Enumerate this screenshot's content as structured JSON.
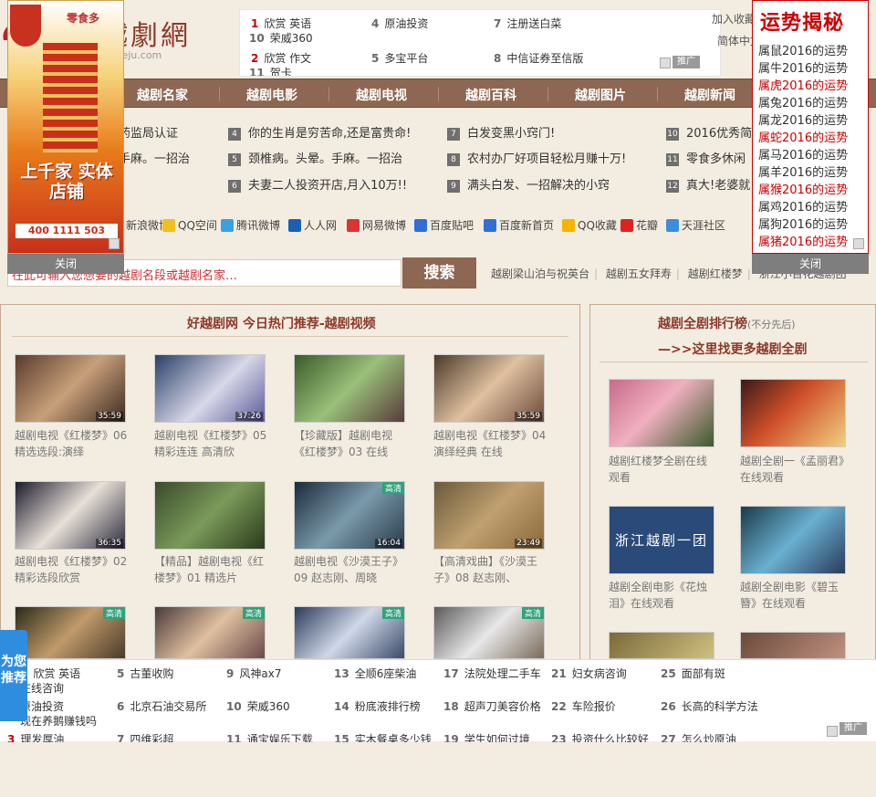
{
  "logo": {
    "text": "越劇網",
    "url": "yueju.com"
  },
  "top_ad": {
    "items": [
      {
        "n": "1",
        "label": "欣赏 英语"
      },
      {
        "n": "4",
        "label": "原油投资"
      },
      {
        "n": "7",
        "label": "注册送白菜"
      },
      {
        "n": "10",
        "label": "荣威360"
      },
      {
        "n": "2",
        "label": "欣赏 作文"
      },
      {
        "n": "5",
        "label": "多宝平台"
      },
      {
        "n": "8",
        "label": "中信证券至信版"
      },
      {
        "n": "11",
        "label": "贺卡"
      }
    ],
    "ad_tag": "推广"
  },
  "top_links": {
    "favorite": "加入收藏",
    "simplified": "简体中文"
  },
  "nav": [
    "越剧名家",
    "越剧电影",
    "越剧电视",
    "越剧百科",
    "越剧图片",
    "越剧新闻"
  ],
  "news": {
    "col1": [
      {
        "n": "",
        "t": "药监局认证"
      },
      {
        "n": "",
        "t": "手麻。一招治"
      },
      {
        "n": "",
        "t": "!"
      }
    ],
    "col2": [
      {
        "n": "4",
        "t": "你的生肖是穷苦命,还是富贵命!"
      },
      {
        "n": "5",
        "t": "颈椎病。头晕。手麻。一招治"
      },
      {
        "n": "6",
        "t": "夫妻二人投资开店,月入10万!!"
      }
    ],
    "col3": [
      {
        "n": "7",
        "t": "白发变黑小窍门!"
      },
      {
        "n": "8",
        "t": "农村办厂好项目轻松月赚十万!"
      },
      {
        "n": "9",
        "t": "满头白发、一招解决的小窍"
      }
    ],
    "col4": [
      {
        "n": "10",
        "t": "2016优秀简历"
      },
      {
        "n": "11",
        "t": "零食多休闲"
      },
      {
        "n": "12",
        "t": "真大!老婆就"
      }
    ]
  },
  "share": [
    "新浪微博",
    "QQ空间",
    "腾讯微博",
    "人人网",
    "网易微博",
    "百度贴吧",
    "百度新首页",
    "QQ收藏",
    "花瓣",
    "天涯社区"
  ],
  "search": {
    "placeholder": "在此可输入您想要的越剧名段或越剧名家…",
    "button": "搜索",
    "hot": [
      "越剧梁山泊与祝英台",
      "越剧五女拜寿",
      "越剧红楼梦",
      "浙江小百花越剧团"
    ]
  },
  "left_panel": {
    "title": "好越剧网 今日热门推荐-越剧视频",
    "videos": [
      {
        "cap": "越剧电视《红楼梦》06 精选选段:演绎",
        "dur": "35:59",
        "hd": ""
      },
      {
        "cap": "越剧电视《红楼梦》05 精彩连连 高清欣",
        "dur": "37:26",
        "hd": ""
      },
      {
        "cap": "【珍藏版】越剧电视《红楼梦》03 在线",
        "dur": "",
        "hd": ""
      },
      {
        "cap": "越剧电视《红楼梦》04 演绎经典 在线",
        "dur": "35:59",
        "hd": ""
      },
      {
        "cap": "越剧电视《红楼梦》02 精彩选段欣赏",
        "dur": "36:35",
        "hd": ""
      },
      {
        "cap": "【精品】越剧电视《红楼梦》01 精选片",
        "dur": "",
        "hd": ""
      },
      {
        "cap": "越剧电视《沙漠王子》09 赵志刚、周晓",
        "dur": "16:04",
        "hd": "高清"
      },
      {
        "cap": "【高清戏曲】《沙漠王子》08 赵志刚、",
        "dur": "23:49",
        "hd": ""
      },
      {
        "cap": "",
        "dur": "",
        "hd": "高清"
      },
      {
        "cap": "",
        "dur": "",
        "hd": "高清"
      },
      {
        "cap": "",
        "dur": "",
        "hd": "高清"
      },
      {
        "cap": "",
        "dur": "",
        "hd": "高清"
      }
    ]
  },
  "right_panel": {
    "title": "越剧全剧排行榜",
    "subtitle": "(不分先后)",
    "more": "—>>这里找更多越剧全剧",
    "items": [
      {
        "cap": "越剧红楼梦全剧在线观看"
      },
      {
        "cap": "越剧全剧一《孟丽君》在线观看"
      },
      {
        "cap": "越剧全剧电影《花烛泪》在线观看"
      },
      {
        "cap": "越剧全剧电影《碧玉簪》在线观看"
      }
    ],
    "film_text": "浙江越剧一团"
  },
  "left_float_ad": {
    "slogan": "上千家 实体店铺",
    "brand": "零食多",
    "phone": "400 1111 503",
    "close": "关闭"
  },
  "luck": {
    "title": "运势揭秘",
    "items": [
      {
        "t": "属鼠2016的运势",
        "red": false
      },
      {
        "t": "属牛2016的运势",
        "red": false
      },
      {
        "t": "属虎2016的运势",
        "red": true
      },
      {
        "t": "属兔2016的运势",
        "red": false
      },
      {
        "t": "属龙2016的运势",
        "red": false
      },
      {
        "t": "属蛇2016的运势",
        "red": true
      },
      {
        "t": "属马2016的运势",
        "red": false
      },
      {
        "t": "属羊2016的运势",
        "red": false
      },
      {
        "t": "属猴2016的运势",
        "red": true
      },
      {
        "t": "属鸡2016的运势",
        "red": false
      },
      {
        "t": "属狗2016的运势",
        "red": false
      },
      {
        "t": "属猪2016的运势",
        "red": true
      }
    ],
    "close": "关闭"
  },
  "float_tab": "为您推荐",
  "bottom_ad": {
    "items": [
      {
        "n": "1",
        "t": "欣赏 英语"
      },
      {
        "n": "5",
        "t": "古董收购"
      },
      {
        "n": "9",
        "t": "风神ax7"
      },
      {
        "n": "13",
        "t": "全顺6座柴油"
      },
      {
        "n": "17",
        "t": "法院处理二手车"
      },
      {
        "n": "21",
        "t": "妇女病咨询"
      },
      {
        "n": "25",
        "t": "面部有斑"
      },
      {
        "n": "",
        "t": "在线咨询"
      },
      {
        "n": "",
        "t": "原油投资"
      },
      {
        "n": "6",
        "t": "北京石油交易所"
      },
      {
        "n": "10",
        "t": "荣威360"
      },
      {
        "n": "14",
        "t": "粉底液排行榜"
      },
      {
        "n": "18",
        "t": "超声刀美容价格"
      },
      {
        "n": "22",
        "t": "车险报价"
      },
      {
        "n": "26",
        "t": "长高的科学方法"
      },
      {
        "n": "",
        "t": "现在养鹅赚钱吗"
      },
      {
        "n": "3",
        "t": "理发厚油"
      },
      {
        "n": "7",
        "t": "四维彩超"
      },
      {
        "n": "11",
        "t": "通宝娱乐下载"
      },
      {
        "n": "15",
        "t": "实木餐桌多少钱"
      },
      {
        "n": "19",
        "t": "学生如何过境"
      },
      {
        "n": "23",
        "t": "投资什么比较好"
      },
      {
        "n": "27",
        "t": "怎么炒原油"
      }
    ],
    "ad_tag": "推广"
  }
}
